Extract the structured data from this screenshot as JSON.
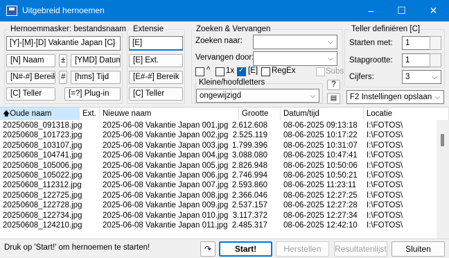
{
  "window": {
    "title": "Uitgebreid hernoemen",
    "controls": [
      "–",
      "☐",
      "✕"
    ]
  },
  "mask": {
    "group_label": "Hernoemmasker: bestandsnaam",
    "value": "[Y]-[M]-[D] Vakantie Japan [C]",
    "buttons": {
      "name": "[N]  Naam",
      "plus": "±",
      "date": "[YMD]  Datum",
      "range": "[N#-#] Bereik",
      "hash": "#",
      "time": "[hms]  Tijd",
      "counter": "[C]  Teller",
      "plugin": "[=?]  Plug-in"
    }
  },
  "extension": {
    "group_label": "Extensie",
    "value": "[E]",
    "buttons": {
      "ext": "[E]  Ext.",
      "range": "[E#-#] Bereik",
      "counter": "[C]  Teller"
    }
  },
  "search": {
    "group_label": "Zoeken & Vervangen",
    "find_label": "Zoeken naar:",
    "find_value": "",
    "replace_label": "Vervangen door:",
    "replace_value": "",
    "opt_caret": "^",
    "opt_1x": "1x",
    "opt_e": "[E]",
    "opt_e_checked": true,
    "opt_regex": "RegEx",
    "opt_subs": "Subs",
    "case_label": "Kleine/hoofdletters",
    "case_value": "ongewijzigd",
    "help": "?"
  },
  "counter": {
    "group_label": "Teller definiëren [C]",
    "start_label": "Starten met:",
    "start_value": "1",
    "step_label": "Stapgrootte:",
    "step_value": "1",
    "digits_label": "Cijfers:",
    "digits_value": "3",
    "save_settings": "F2 Instellingen opslaan"
  },
  "list": {
    "columns": [
      "Oude naam",
      "Ext.",
      "Nieuwe naam",
      "Grootte",
      "Datum/tijd",
      "Locatie"
    ],
    "sort_glyph": "🡅",
    "rows": [
      [
        "20250608_091318.jpg",
        "",
        "2025-06-08 Vakantie Japan 001.jpg",
        "2.612.608",
        "08-06-2025 09:13:18",
        "I:\\FOTOS\\"
      ],
      [
        "20250608_101723.jpg",
        "",
        "2025-06-08 Vakantie Japan 002.jpg",
        "2.525.119",
        "08-06-2025 10:17:22",
        "I:\\FOTOS\\"
      ],
      [
        "20250608_103107.jpg",
        "",
        "2025-06-08 Vakantie Japan 003.jpg",
        "1.799.396",
        "08-06-2025 10:31:07",
        "I:\\FOTOS\\"
      ],
      [
        "20250608_104741.jpg",
        "",
        "2025-06-08 Vakantie Japan 004.jpg",
        "3.088.080",
        "08-06-2025 10:47:41",
        "I:\\FOTOS\\"
      ],
      [
        "20250608_105006.jpg",
        "",
        "2025-06-08 Vakantie Japan 005.jpg",
        "2.826.948",
        "08-06-2025 10:50:06",
        "I:\\FOTOS\\"
      ],
      [
        "20250608_105022.jpg",
        "",
        "2025-06-08 Vakantie Japan 006.jpg",
        "2.746.994",
        "08-06-2025 10:50:21",
        "I:\\FOTOS\\"
      ],
      [
        "20250608_112312.jpg",
        "",
        "2025-06-08 Vakantie Japan 007.jpg",
        "2.593.860",
        "08-06-2025 11:23:11",
        "I:\\FOTOS\\"
      ],
      [
        "20250608_122725.jpg",
        "",
        "2025-06-08 Vakantie Japan 008.jpg",
        "2.366.046",
        "08-06-2025 12:27:25",
        "I:\\FOTOS\\"
      ],
      [
        "20250608_122728.jpg",
        "",
        "2025-06-08 Vakantie Japan 009.jpg",
        "2.537.157",
        "08-06-2025 12:27:28",
        "I:\\FOTOS\\"
      ],
      [
        "20250608_122734.jpg",
        "",
        "2025-06-08 Vakantie Japan 010.jpg",
        "3.117.372",
        "08-06-2025 12:27:34",
        "I:\\FOTOS\\"
      ],
      [
        "20250608_124210.jpg",
        "",
        "2025-06-08 Vakantie Japan 011.jpg",
        "2.485.317",
        "08-06-2025 12:42:10",
        "I:\\FOTOS\\"
      ]
    ]
  },
  "statusbar": {
    "message": "Druk op 'Start!' om hernoemen te starten!",
    "undo_icon": "↷",
    "start": "Start!",
    "restore": "Herstellen",
    "results": "Resultatenlijst",
    "close": "Sluiten"
  }
}
